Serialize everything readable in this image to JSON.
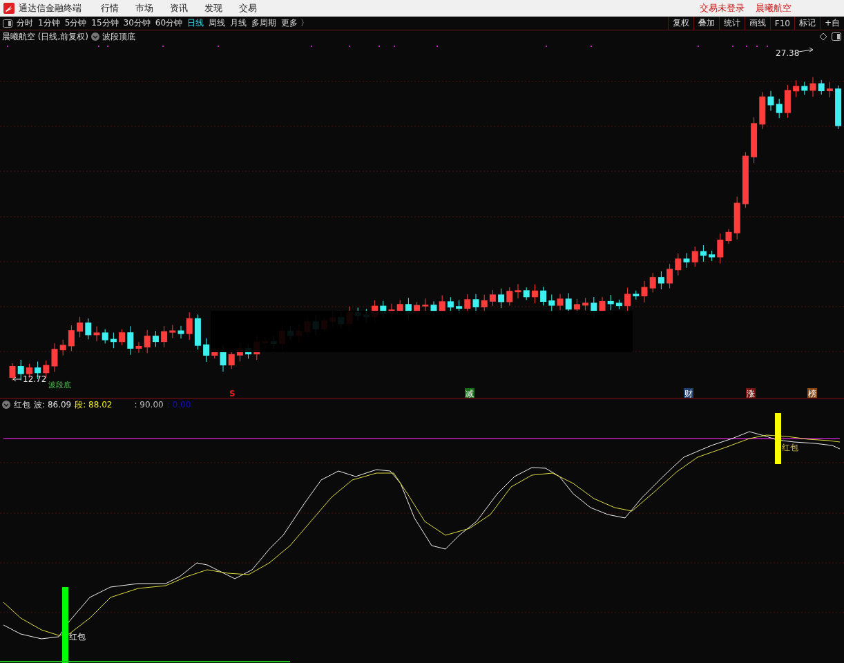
{
  "app": {
    "title": "通达信金融终端",
    "menu": [
      "行情",
      "市场",
      "资讯",
      "发现",
      "交易"
    ],
    "login_status": "交易未登录",
    "account": "晨曦航空"
  },
  "periods": [
    {
      "label": "分时",
      "selected": false
    },
    {
      "label": "1分钟",
      "selected": false
    },
    {
      "label": "5分钟",
      "selected": false
    },
    {
      "label": "15分钟",
      "selected": false
    },
    {
      "label": "30分钟",
      "selected": false
    },
    {
      "label": "60分钟",
      "selected": false
    },
    {
      "label": "日线",
      "selected": true
    },
    {
      "label": "周线",
      "selected": false
    },
    {
      "label": "月线",
      "selected": false
    },
    {
      "label": "多周期",
      "selected": false
    },
    {
      "label": "更多 〉",
      "selected": false
    }
  ],
  "tools": [
    "复权",
    "叠加",
    "统计",
    "画线",
    "F10",
    "标记",
    "+自"
  ],
  "chart": {
    "title": "晨曦航空 (日线,前复权)",
    "indicator": "波段顶底",
    "high_label": "27.38",
    "low_label": "12.72",
    "low_note": "波段底",
    "markers": [
      {
        "text": "S",
        "kind": "letter",
        "color": "#e02020"
      },
      {
        "text": "减",
        "kind": "tag",
        "color": "#1a6b1a"
      },
      {
        "text": "财",
        "kind": "tag",
        "color": "#1c3f6e"
      },
      {
        "text": "涨",
        "kind": "tag",
        "color": "#7a1010"
      },
      {
        "text": "榜",
        "kind": "tag",
        "color": "#8a4a10"
      }
    ]
  },
  "indicator": {
    "name": "红包",
    "values": [
      {
        "label": "波:",
        "value": "86.09",
        "color": "#e0e0e0"
      },
      {
        "label": "段:",
        "value": "88.02",
        "color": "#f0f020"
      },
      {
        "label": ":",
        "value": "90.00",
        "color": "#c0c0c0"
      },
      {
        "label": ":",
        "value": "0.00",
        "color": "#1010c0"
      }
    ],
    "signals": [
      {
        "label": "红包",
        "color": "#00ff00"
      },
      {
        "label": "红包",
        "color": "#ffff00"
      }
    ]
  }
}
